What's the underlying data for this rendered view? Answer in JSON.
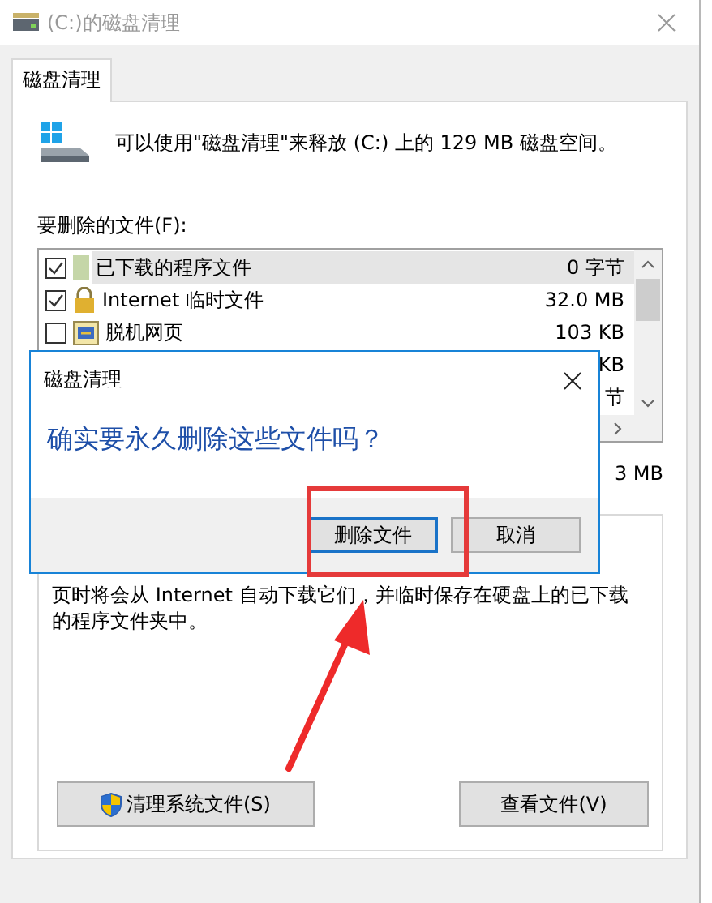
{
  "window": {
    "title": "(C:)的磁盘清理"
  },
  "tabs": [
    {
      "label": "磁盘清理",
      "selected": true
    }
  ],
  "summary": "可以使用\"磁盘清理\"来释放 (C:) 上的 129 MB 磁盘空间。",
  "files_label": "要删除的文件(F):",
  "files": [
    {
      "kind": "folder",
      "name": "已下载的程序文件",
      "size": "0 字节",
      "checked": true,
      "selected": true
    },
    {
      "kind": "lock",
      "name": "Internet 临时文件",
      "size": "32.0 MB",
      "checked": true,
      "selected": false
    },
    {
      "kind": "offline",
      "name": "脱机网页",
      "size": "103 KB",
      "checked": false,
      "selected": false
    },
    {
      "kind": "hidden",
      "size": "KB"
    },
    {
      "kind": "hidden",
      "size": "节"
    }
  ],
  "total_size": "3 MB",
  "description": "页时将会从 Internet 自动下载它们，并临时保存在硬盘上的已下载的程序文件夹中。",
  "buttons": [
    {
      "kind": "shield",
      "label": "清理系统文件(S)"
    },
    {
      "kind": "plain",
      "label": "查看文件(V)"
    }
  ],
  "dialog": {
    "title": "磁盘清理",
    "message": "确实要永久删除这些文件吗？",
    "buttons": [
      {
        "label": "删除文件",
        "default": true
      },
      {
        "label": "取消",
        "default": false
      }
    ]
  }
}
